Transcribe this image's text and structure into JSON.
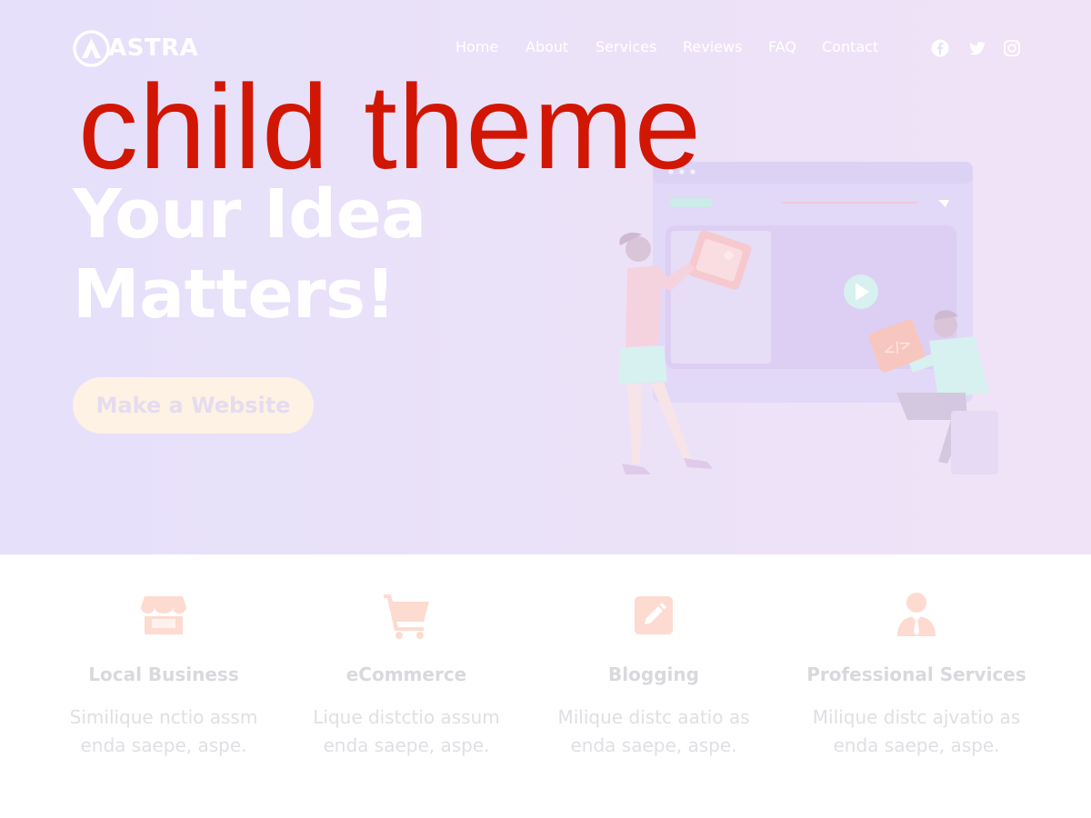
{
  "brand": {
    "name": "ASTRA"
  },
  "nav": {
    "items": [
      {
        "label": "Home"
      },
      {
        "label": "About"
      },
      {
        "label": "Services"
      },
      {
        "label": "Reviews"
      },
      {
        "label": "FAQ"
      },
      {
        "label": "Contact"
      }
    ]
  },
  "social": {
    "icons": [
      "facebook-icon",
      "twitter-icon",
      "instagram-icon"
    ]
  },
  "overlay": {
    "text": "child theme",
    "color": "#d21604"
  },
  "hero": {
    "title_line1": "Your Idea",
    "title_line2": "Matters!",
    "cta_label": "Make a Website"
  },
  "features": [
    {
      "icon": "store-icon",
      "title": "Local Business",
      "desc_line1": "Similique nctio assm",
      "desc_line2": "enda saepe, aspe."
    },
    {
      "icon": "cart-icon",
      "title": "eCommerce",
      "desc_line1": "Lique distctio assum",
      "desc_line2": "enda saepe, aspe."
    },
    {
      "icon": "edit-icon",
      "title": "Blogging",
      "desc_line1": "Milique distc aatio as",
      "desc_line2": "enda saepe, aspe."
    },
    {
      "icon": "person-icon",
      "title": "Professional Services",
      "desc_line1": "Milique distc ajvatio as",
      "desc_line2": "enda saepe, aspe."
    }
  ],
  "colors": {
    "hero_bg": "#e8e1fa",
    "accent_icon": "#fde0d6",
    "cta_bg": "#fdf2e4"
  }
}
